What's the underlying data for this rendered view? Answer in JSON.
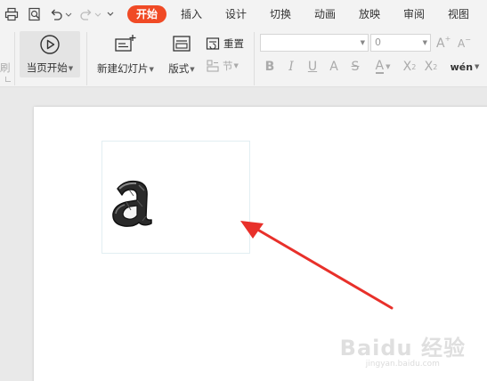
{
  "quick_access": {
    "icons": [
      "print-icon",
      "print-preview-icon",
      "undo-icon",
      "undo-dropdown-icon",
      "redo-icon",
      "redo-dropdown-icon",
      "customize-chevron-icon"
    ]
  },
  "tabs": [
    {
      "label": "开始",
      "active": true
    },
    {
      "label": "插入",
      "active": false
    },
    {
      "label": "设计",
      "active": false
    },
    {
      "label": "切换",
      "active": false
    },
    {
      "label": "动画",
      "active": false
    },
    {
      "label": "放映",
      "active": false
    },
    {
      "label": "审阅",
      "active": false
    },
    {
      "label": "视图",
      "active": false
    }
  ],
  "ribbon": {
    "left_cut_label": "刷",
    "play_current_label": "当页开始",
    "new_slide_label": "新建幻灯片",
    "layout_label": "版式",
    "reset_label": "重置",
    "section_label": "节",
    "font_name_value": "",
    "font_size_value": "0"
  },
  "slide": {
    "textbox_content": "a"
  },
  "watermark": {
    "main": "Baidu 经验",
    "sub": "jingyan.baidu.com"
  },
  "colors": {
    "accent": "#f04a25",
    "arrow": "#e8302a",
    "ribbon_bg": "#f3f3f3",
    "canvas_bg": "#e9e9e9"
  }
}
